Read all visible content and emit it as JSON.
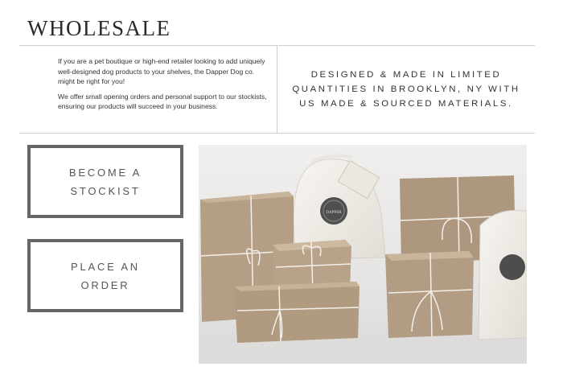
{
  "header": {
    "title": "WHOLESALE"
  },
  "intro": {
    "paragraph1": "If you are a pet boutique or high-end retailer looking to add uniquely well-designed dog products to your shelves, the Dapper Dog co. might be right for you!",
    "paragraph2": "We offer small opening orders and personal support to our stockists, ensuring our products will succeed in your business."
  },
  "tagline": "DESIGNED & MADE IN LIMITED QUANTITIES IN BROOKLYN, NY WITH US MADE & SOURCED MATERIALS.",
  "actions": {
    "stockist_label": "BECOME A STOCKIST",
    "order_label": "PLACE AN ORDER"
  },
  "photo": {
    "bag_label": "DAPPER DOG CO.",
    "colors": {
      "kraft": "#b59f86",
      "kraft_dark": "#8f7a63",
      "cloth": "#f1efea",
      "string": "#f7f5f0",
      "background": "#e8e7e6"
    }
  }
}
